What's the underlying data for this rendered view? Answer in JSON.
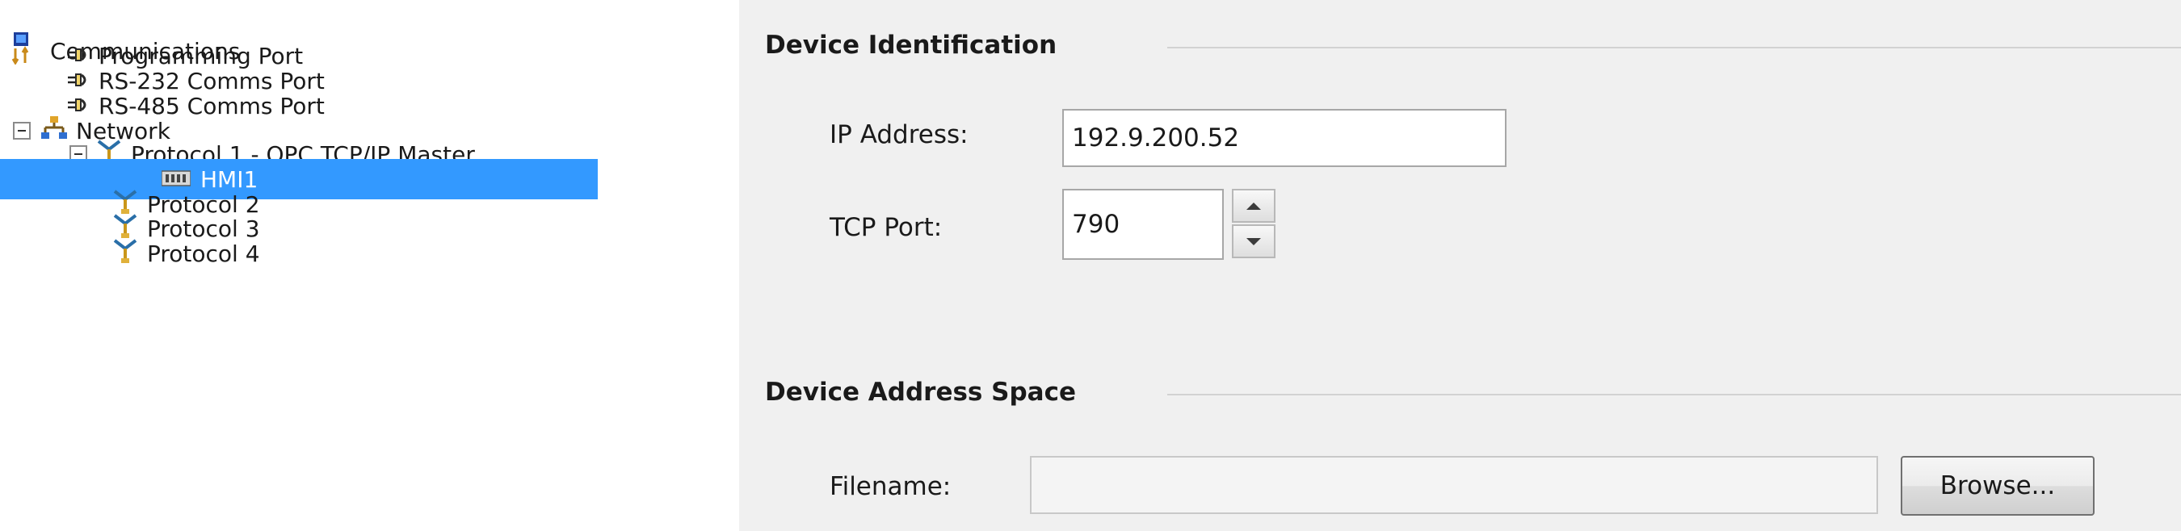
{
  "tree": {
    "items": [
      {
        "label": "Communications",
        "icon": "communications-icon"
      },
      {
        "label": "Programming Port",
        "icon": "port-connector-icon"
      },
      {
        "label": "RS-232 Comms Port",
        "icon": "port-connector-icon"
      },
      {
        "label": "RS-485 Comms Port",
        "icon": "port-connector-icon"
      },
      {
        "label": "Network",
        "icon": "network-icon",
        "expanded": true
      },
      {
        "label": "Protocol 1 - OPC TCP/IP Master",
        "icon": "protocol-icon",
        "expanded": true
      },
      {
        "label": "HMI1",
        "icon": "device-icon",
        "selected": true
      },
      {
        "label": "Protocol 2",
        "icon": "protocol-icon"
      },
      {
        "label": "Protocol 3",
        "icon": "protocol-icon"
      },
      {
        "label": "Protocol 4",
        "icon": "protocol-icon"
      }
    ]
  },
  "device_identification": {
    "title": "Device Identification",
    "ip_address_label": "IP Address:",
    "ip_address_value": "192.9.200.52",
    "tcp_port_label": "TCP Port:",
    "tcp_port_value": "790"
  },
  "device_address_space": {
    "title": "Device Address Space",
    "filename_label": "Filename:",
    "filename_value": "",
    "browse_label": "Browse..."
  },
  "colors": {
    "selection": "#3399ff",
    "panel_background": "#f0f0f0",
    "tree_background": "#ffffff"
  }
}
